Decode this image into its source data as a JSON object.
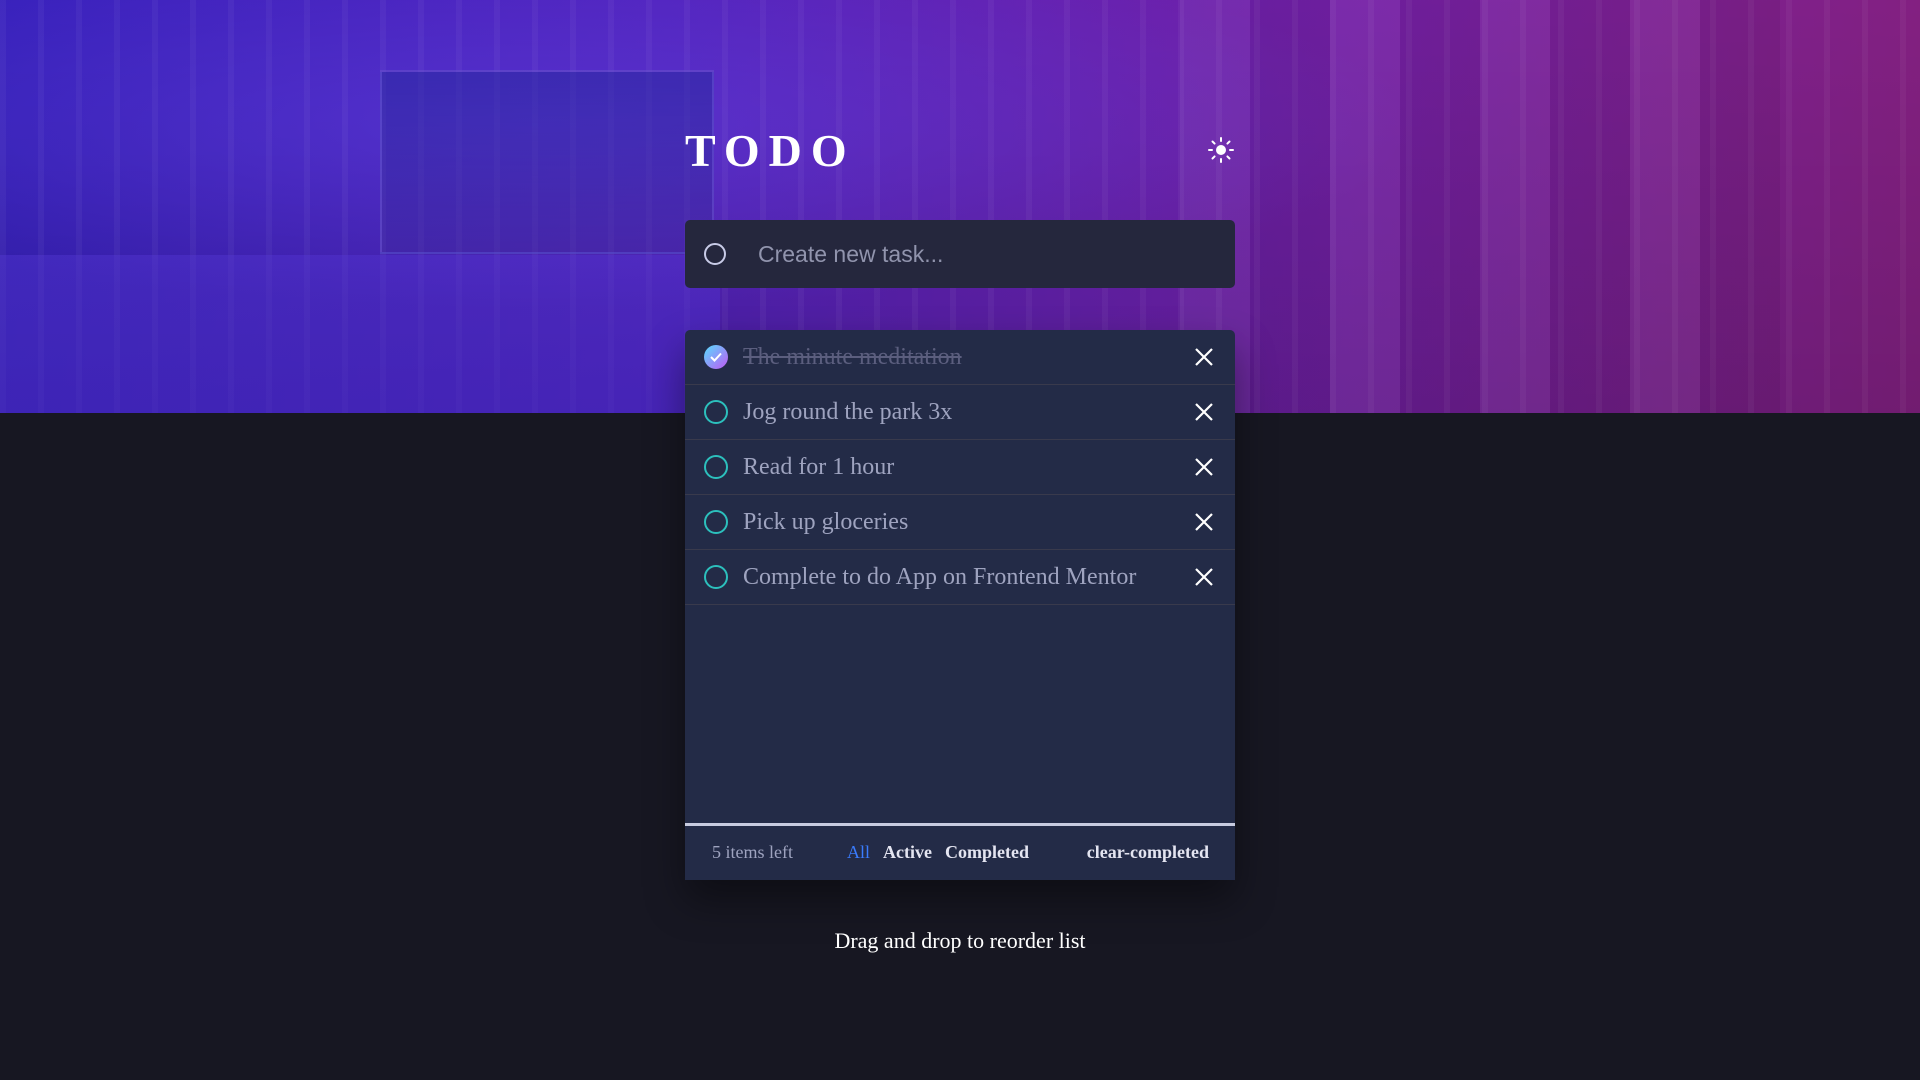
{
  "header": {
    "title": "TODO",
    "theme_icon": "sun-icon"
  },
  "new_task": {
    "placeholder": "Create new task...",
    "value": ""
  },
  "todos": [
    {
      "text": "The minute meditation",
      "completed": true
    },
    {
      "text": "Jog round the park 3x",
      "completed": false
    },
    {
      "text": "Read for 1 hour",
      "completed": false
    },
    {
      "text": "Pick up gloceries",
      "completed": false
    },
    {
      "text": "Complete to do App on Frontend Mentor",
      "completed": false
    }
  ],
  "footer": {
    "items_left": "5 items left",
    "filters": [
      "All",
      "Active",
      "Completed"
    ],
    "active_filter": "All",
    "clear_label": "clear-completed"
  },
  "hint": "Drag and drop to reorder list",
  "colors": {
    "check_gradient_start": "#57ddff",
    "check_gradient_end": "#c058f3",
    "active_filter": "#3a7cfd",
    "panel": "#232b47",
    "page_background": "#171722"
  }
}
